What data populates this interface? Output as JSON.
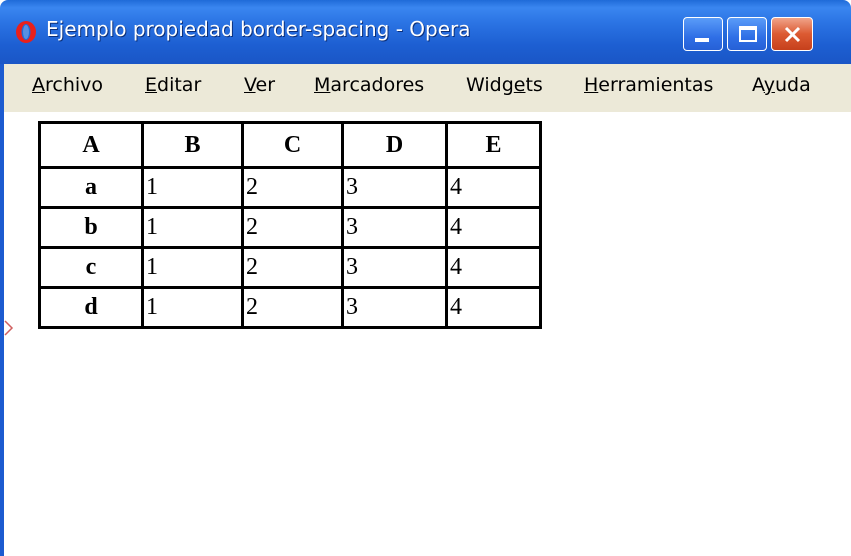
{
  "window": {
    "title": "Ejemplo propiedad border-spacing - Opera",
    "icon": "opera-logo-icon",
    "controls": {
      "minimize_icon": "minimize-icon",
      "maximize_icon": "maximize-icon",
      "close_icon": "close-icon"
    }
  },
  "menubar": {
    "items": [
      {
        "pre": "",
        "key": "A",
        "post": "rchivo"
      },
      {
        "pre": "",
        "key": "E",
        "post": "ditar"
      },
      {
        "pre": "",
        "key": "V",
        "post": "er"
      },
      {
        "pre": "",
        "key": "M",
        "post": "arcadores"
      },
      {
        "pre": "Widg",
        "key": "e",
        "post": "ts"
      },
      {
        "pre": "",
        "key": "H",
        "post": "erramientas"
      },
      {
        "pre": "A",
        "key": "y",
        "post": "uda"
      }
    ]
  },
  "table": {
    "headers": [
      "A",
      "B",
      "C",
      "D",
      "E"
    ],
    "rows": [
      [
        "a",
        "1",
        "2",
        "3",
        "4"
      ],
      [
        "b",
        "1",
        "2",
        "3",
        "4"
      ],
      [
        "c",
        "1",
        "2",
        "3",
        "4"
      ],
      [
        "d",
        "1",
        "2",
        "3",
        "4"
      ]
    ]
  },
  "colors": {
    "titlebar": "#2b74e4",
    "menubar": "#ece9d8",
    "close_button": "#dc5a32"
  }
}
